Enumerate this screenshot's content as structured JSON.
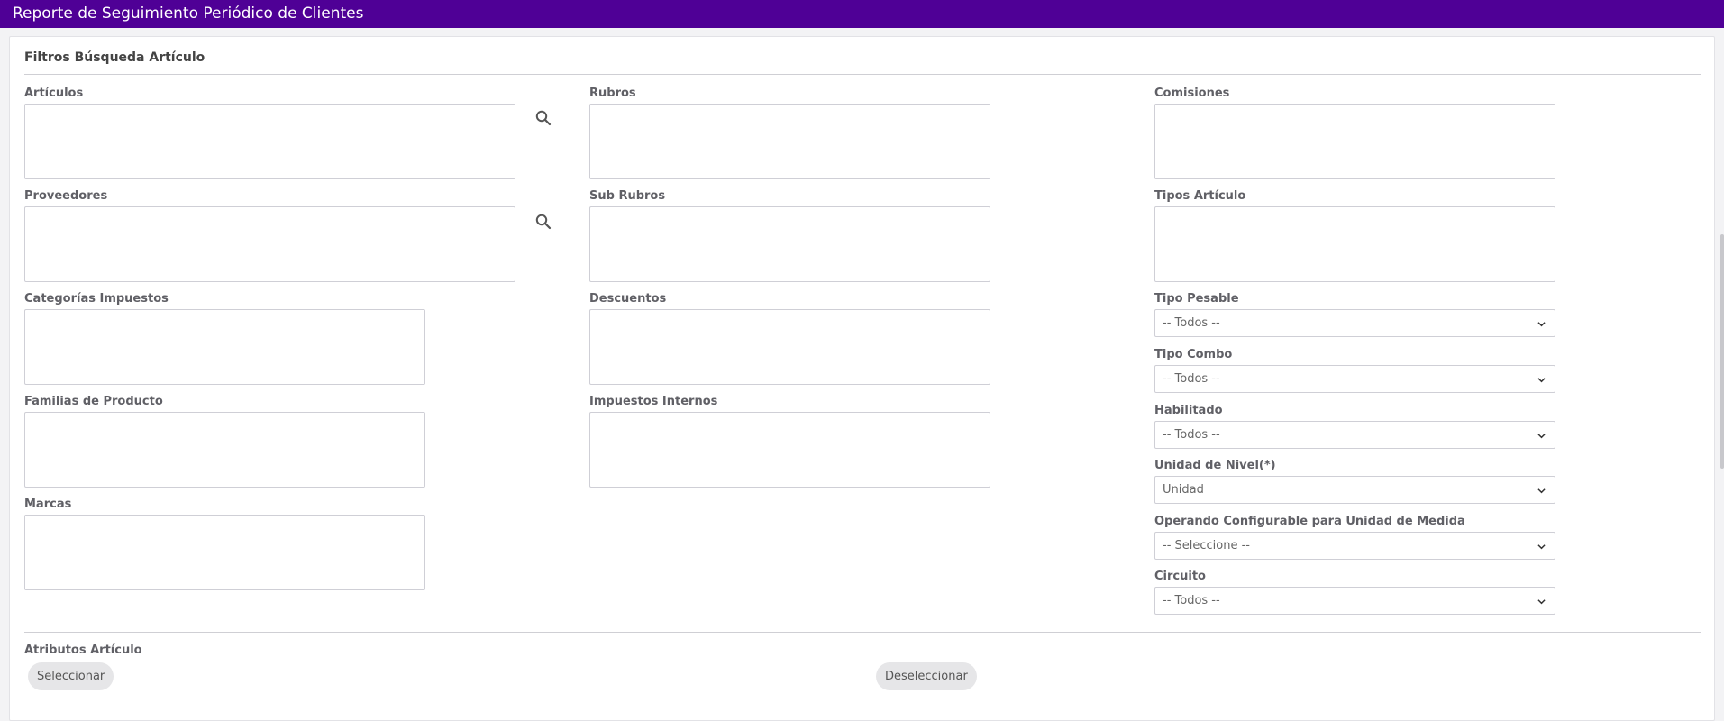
{
  "header": {
    "title": "Reporte de Seguimiento Periódico de Clientes"
  },
  "filtros": {
    "title": "Filtros Búsqueda Artículo",
    "col1": {
      "articulos": "Artículos",
      "proveedores": "Proveedores",
      "categorias": "Categorías Impuestos",
      "familias": "Familias de Producto",
      "marcas": "Marcas"
    },
    "col2": {
      "rubros": "Rubros",
      "sub_rubros": "Sub Rubros",
      "descuentos": "Descuentos",
      "impuestos_internos": "Impuestos Internos"
    },
    "col3": {
      "comisiones": "Comisiones",
      "tipos_articulo": "Tipos Artículo",
      "tipo_pesable": {
        "label": "Tipo Pesable",
        "value": "-- Todos --"
      },
      "tipo_combo": {
        "label": "Tipo Combo",
        "value": "-- Todos --"
      },
      "habilitado": {
        "label": "Habilitado",
        "value": "-- Todos --"
      },
      "unidad_nivel": {
        "label": "Unidad de Nivel(*)",
        "value": "Unidad"
      },
      "operando": {
        "label": "Operando Configurable para Unidad de Medida",
        "value": "-- Seleccione --"
      },
      "circuito": {
        "label": "Circuito",
        "value": "-- Todos --"
      }
    }
  },
  "atributos": {
    "title": "Atributos Artículo",
    "select_label": "Seleccionar",
    "deselect_label": "Deseleccionar"
  },
  "icons": {
    "search": "search-icon",
    "chevron": "chevron-down-icon"
  },
  "colors": {
    "header_bg": "#4f0096"
  }
}
